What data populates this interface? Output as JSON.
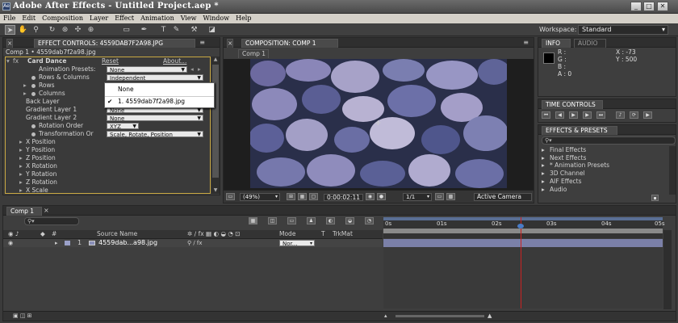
{
  "window": {
    "app_icon": "Ae",
    "title": "Adobe After Effects - Untitled Project.aep *",
    "controls": [
      "_",
      "□",
      "✕"
    ]
  },
  "menu": [
    "File",
    "Edit",
    "Composition",
    "Layer",
    "Effect",
    "Animation",
    "View",
    "Window",
    "Help"
  ],
  "toolbar": {
    "tools": [
      "selection-tool",
      "hand-tool",
      "zoom-tool",
      "rotation-tool",
      "orbit-camera-tool",
      "pan-behind-tool",
      "rectangle-mask-tool",
      "pen-tool",
      "type-tool",
      "brush-tool",
      "clone-stamp-tool",
      "eraser-tool"
    ],
    "workspace_label": "Workspace:",
    "workspace_value": "Standard"
  },
  "effect_controls": {
    "tab_label": "EFFECT CONTROLS: 4559dab7f2a98.jpg",
    "breadcrumb": "Comp 1 • 4559dab7f2a98.jpg",
    "effect_name": "Card Dance",
    "reset_label": "Reset",
    "about_label": "About...",
    "rows": [
      {
        "label": "Animation Presets:",
        "value": "None"
      },
      {
        "label": "Rows & Columns",
        "value": "Independent"
      },
      {
        "label": "Rows",
        "value": ""
      },
      {
        "label": "Columns",
        "value": ""
      },
      {
        "label": "Back Layer",
        "value": ""
      },
      {
        "label": "Gradient Layer 1",
        "value": "None"
      },
      {
        "label": "Gradient Layer 2",
        "value": "None"
      },
      {
        "label": "Rotation Order",
        "value": "XYZ"
      },
      {
        "label": "Transformation Or",
        "value": "Scale, Rotate, Position"
      },
      {
        "label": "X Position",
        "value": ""
      },
      {
        "label": "Y Position",
        "value": ""
      },
      {
        "label": "Z Position",
        "value": ""
      },
      {
        "label": "X Rotation",
        "value": ""
      },
      {
        "label": "Y Rotation",
        "value": ""
      },
      {
        "label": "Z Rotation",
        "value": ""
      },
      {
        "label": "X Scale",
        "value": ""
      },
      {
        "label": "Y Scale",
        "value": ""
      }
    ],
    "popup": {
      "items": [
        "None",
        "1. 4559dab7f2a98.jpg"
      ],
      "checked_index": 1
    }
  },
  "composition": {
    "tab_label": "COMPOSITION: Comp 1",
    "breadcrumb_tab": "Comp 1",
    "zoom": "(49%)",
    "timecode": "0:00:02:11",
    "resolution": "1/1",
    "camera": "Active Camera"
  },
  "info": {
    "tabs": [
      "INFO",
      "AUDIO"
    ],
    "r": "R :",
    "g": "G :",
    "b": "B :",
    "a": "A : 0",
    "x": "X : -73",
    "y": "Y : 500"
  },
  "time_controls": {
    "tab_label": "TIME CONTROLS"
  },
  "effects_presets": {
    "tab_label": "EFFECTS & PRESETS",
    "items": [
      "Final Effects",
      "Next Effects",
      "* Animation Presets",
      "3D Channel",
      "AIF Effects",
      "Audio"
    ]
  },
  "timeline": {
    "tab_label": "Comp 1",
    "ruler_ticks": [
      "0s",
      "01s",
      "02s",
      "03s",
      "04s",
      "05s"
    ],
    "columns": {
      "source_name": "Source Name",
      "mode": "Mode",
      "t": "T",
      "trkmat": "TrkMat"
    },
    "layers": [
      {
        "index": "1",
        "name": "4559dab...a98.jpg",
        "mode": "Nor..."
      }
    ]
  },
  "colors": {
    "panel_bg": "#3e3e3e",
    "accent_blue": "#4a7cc7",
    "playhead": "#cc2222",
    "layer_bar": "#7b80a8"
  }
}
